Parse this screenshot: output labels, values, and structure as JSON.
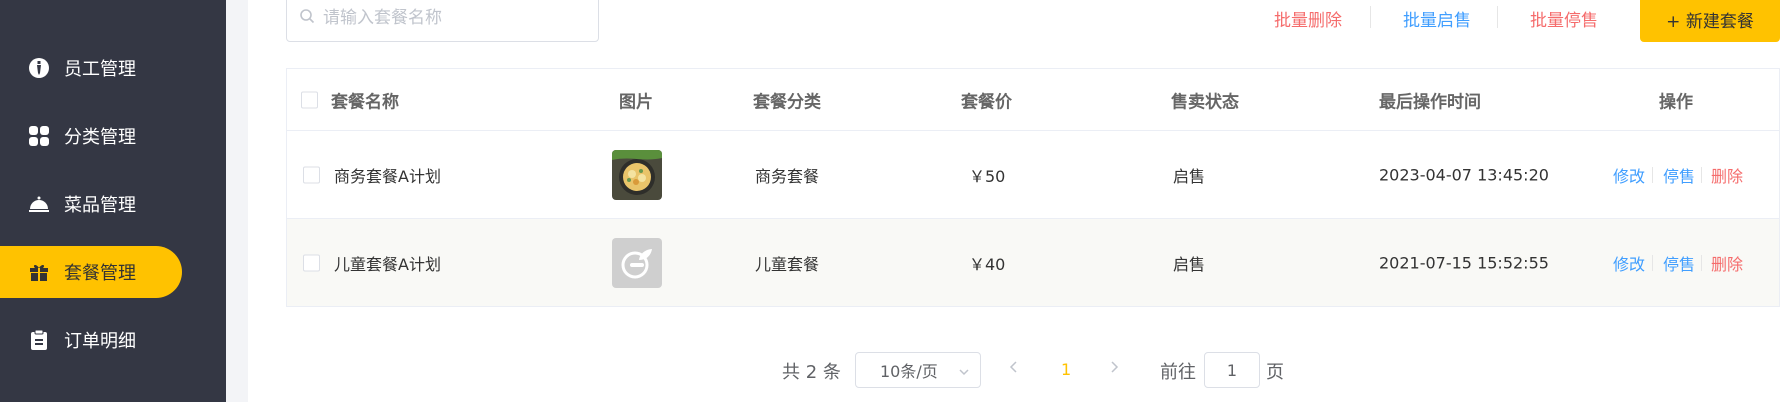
{
  "sidebar": {
    "items": [
      {
        "label": "员工管理",
        "icon": "employee-icon",
        "active": false
      },
      {
        "label": "分类管理",
        "icon": "category-grid-icon",
        "active": false
      },
      {
        "label": "菜品管理",
        "icon": "dish-cloche-icon",
        "active": false
      },
      {
        "label": "套餐管理",
        "icon": "gift-icon",
        "active": true
      },
      {
        "label": "订单明细",
        "icon": "clipboard-icon",
        "active": false
      }
    ]
  },
  "toolbar": {
    "search_placeholder": "请输入套餐名称",
    "batch_delete": "批量删除",
    "batch_enable": "批量启售",
    "batch_disable": "批量停售",
    "new_button": "+ 新建套餐"
  },
  "table": {
    "headers": {
      "name": "套餐名称",
      "image": "图片",
      "category": "套餐分类",
      "price": "套餐价",
      "status": "售卖状态",
      "updated": "最后操作时间",
      "actions": "操作"
    },
    "rows": [
      {
        "name": "商务套餐A计划",
        "category": "商务套餐",
        "price": "￥50",
        "status": "启售",
        "updated": "2023-04-07 13:45:20",
        "edit": "修改",
        "toggle": "停售",
        "delete": "删除",
        "image": "food-photo"
      },
      {
        "name": "儿童套餐A计划",
        "category": "儿童套餐",
        "price": "￥40",
        "status": "启售",
        "updated": "2021-07-15 15:52:55",
        "edit": "修改",
        "toggle": "停售",
        "delete": "删除",
        "image": "placeholder"
      }
    ]
  },
  "pagination": {
    "total_text": "共 2 条",
    "page_size": "10条/页",
    "current_page": "1",
    "goto_prefix": "前往",
    "goto_value": "1",
    "goto_suffix": "页"
  },
  "colors": {
    "sidebar_bg": "#343744",
    "accent": "#ffc200",
    "link_blue": "#409eff",
    "danger_red": "#f56c6c"
  }
}
